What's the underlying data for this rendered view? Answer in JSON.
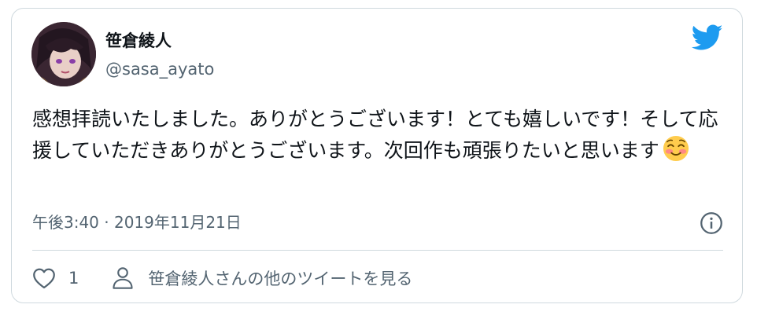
{
  "author": {
    "name": "笹倉綾人",
    "handle": "@sasa_ayato"
  },
  "tweet": {
    "text": "感想拝読いたしました。ありがとうございます！とても嬉しいです！そして応援していただきありがとうございます。次回作も頑張りたいと思います",
    "emoji": "smiling-face-with-blush"
  },
  "timestamp": "午後3:40 · 2019年11月21日",
  "actions": {
    "like_count": "1",
    "profile_link_label": "笹倉綾人さんの他のツイートを見る"
  },
  "colors": {
    "twitter_blue": "#1d9bf0",
    "secondary_text": "#536471",
    "border": "#cfd9de"
  },
  "icons": [
    "twitter-bird-icon",
    "info-icon",
    "heart-icon",
    "person-icon",
    "blush-emoji"
  ]
}
